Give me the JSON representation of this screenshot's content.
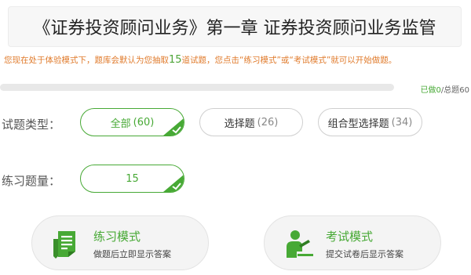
{
  "header": {
    "title": "《证券投资顾问业务》第一章 证券投资顾问业务监管"
  },
  "notice": {
    "prefix": "您现在处于体验模式下，题库会默认为您抽取",
    "count": "15",
    "suffix": "道试题，您点击“练习模式”或“考试模式”就可以开始做题。"
  },
  "progress": {
    "done_label": "已做0",
    "total_label": "/总题60",
    "fraction": 0
  },
  "question_type": {
    "label": "试题类型：",
    "options": [
      {
        "name": "全部",
        "count": "(60)",
        "selected": true
      },
      {
        "name": "选择题",
        "count": "(26)",
        "selected": false
      },
      {
        "name": "组合型选择题",
        "count": "(34)",
        "selected": false
      }
    ]
  },
  "quantity": {
    "label": "练习题量：",
    "value": "15"
  },
  "modes": {
    "practice": {
      "title": "练习模式",
      "desc": "做题后立即显示答案",
      "icon": "practice-sheet-icon"
    },
    "exam": {
      "title": "考试模式",
      "desc": "提交试卷后显示答案",
      "icon": "exam-person-icon"
    }
  },
  "colors": {
    "accent": "#47a935",
    "notice": "#e07b2c"
  }
}
